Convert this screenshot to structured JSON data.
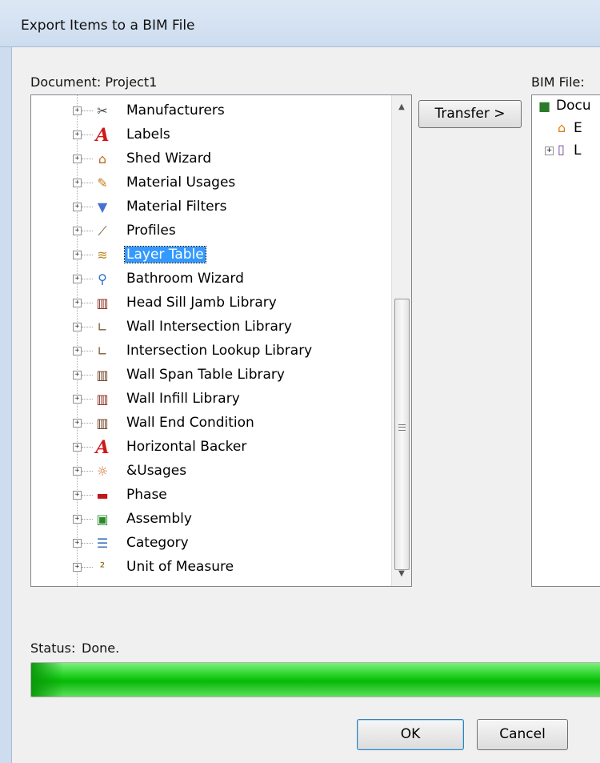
{
  "window": {
    "title": "Export Items to a BIM File"
  },
  "document_label": "Document: Project1",
  "bim_label": "BIM File:",
  "transfer_button": "Transfer >",
  "tree_items": [
    {
      "label": "Manufacturers",
      "icon": "scissors-icon"
    },
    {
      "label": "Labels",
      "icon": "letter-a-icon"
    },
    {
      "label": "Shed Wizard",
      "icon": "shed-icon"
    },
    {
      "label": "Material Usages",
      "icon": "material-usage-icon"
    },
    {
      "label": "Material Filters",
      "icon": "funnel-icon"
    },
    {
      "label": "Profiles",
      "icon": "profile-icon"
    },
    {
      "label": "Layer Table",
      "icon": "layers-icon",
      "selected": true
    },
    {
      "label": "Bathroom Wizard",
      "icon": "restroom-icon"
    },
    {
      "label": "Head Sill Jamb Library",
      "icon": "door-frame-icon"
    },
    {
      "label": "Wall Intersection Library",
      "icon": "l-bracket-icon"
    },
    {
      "label": "Intersection Lookup Library",
      "icon": "l-bracket-icon"
    },
    {
      "label": "Wall Span Table Library",
      "icon": "wall-span-icon"
    },
    {
      "label": "Wall Infill Library",
      "icon": "wall-infill-icon"
    },
    {
      "label": "Wall End Condition",
      "icon": "wall-end-icon"
    },
    {
      "label": "Horizontal Backer",
      "icon": "letter-a-icon"
    },
    {
      "label": "&Usages",
      "icon": "usages-icon"
    },
    {
      "label": "Phase",
      "icon": "truck-icon"
    },
    {
      "label": "Assembly",
      "icon": "assembly-icon"
    },
    {
      "label": "Category",
      "icon": "list-icon"
    },
    {
      "label": "Unit of Measure",
      "icon": "squared-icon"
    }
  ],
  "right_tree": [
    {
      "label": "Docu",
      "icon": "document-icon"
    },
    {
      "label": "E",
      "icon": "house-icon"
    },
    {
      "label": "L",
      "icon": "book-icon"
    }
  ],
  "status_label": "Status:",
  "status_value": "Done.",
  "progress": 1.0,
  "ok_button": "OK",
  "cancel_button": "Cancel"
}
